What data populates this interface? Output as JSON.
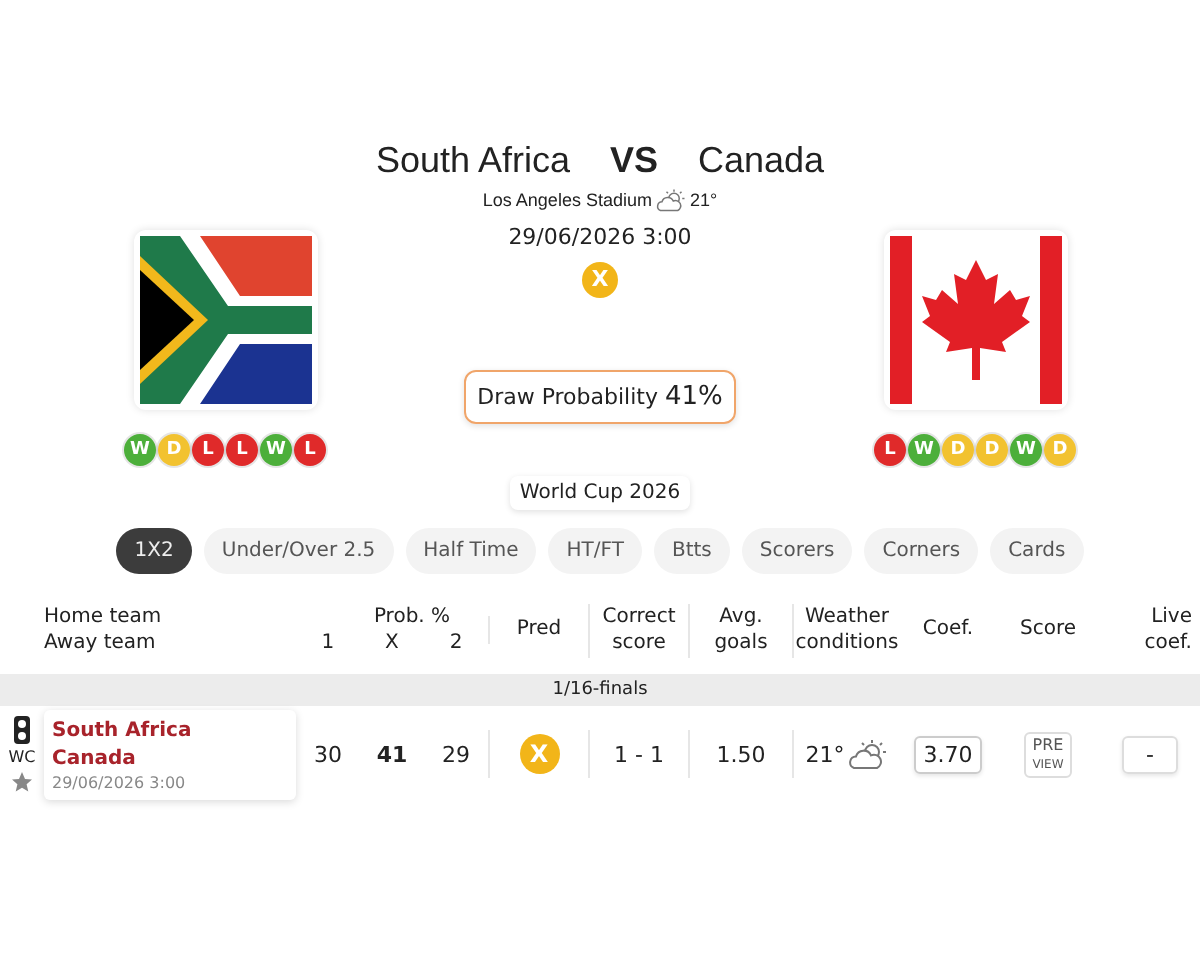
{
  "match": {
    "home": "South Africa",
    "vs": "VS",
    "away": "Canada",
    "venue": "Los Angeles Stadium",
    "temperature": "21°",
    "datetime": "29/06/2026 3:00",
    "prediction": "X",
    "draw_probability": {
      "label": "Draw Probability",
      "value": "41%"
    },
    "competition": "World Cup 2026"
  },
  "home_team": {
    "form": [
      {
        "result": "W",
        "color": "#4caf3a"
      },
      {
        "result": "D",
        "color": "#f2c230"
      },
      {
        "result": "L",
        "color": "#e02a2a"
      },
      {
        "result": "L",
        "color": "#e02a2a"
      },
      {
        "result": "W",
        "color": "#4caf3a"
      },
      {
        "result": "L",
        "color": "#e02a2a"
      }
    ]
  },
  "away_team": {
    "form": [
      {
        "result": "L",
        "color": "#e02a2a"
      },
      {
        "result": "W",
        "color": "#4caf3a"
      },
      {
        "result": "D",
        "color": "#f2c230"
      },
      {
        "result": "D",
        "color": "#f2c230"
      },
      {
        "result": "W",
        "color": "#4caf3a"
      },
      {
        "result": "D",
        "color": "#f2c230"
      }
    ]
  },
  "tabs": [
    {
      "label": "1X2",
      "selected": true
    },
    {
      "label": "Under/Over 2.5",
      "selected": false
    },
    {
      "label": "Half Time",
      "selected": false
    },
    {
      "label": "HT/FT",
      "selected": false
    },
    {
      "label": "Btts",
      "selected": false
    },
    {
      "label": "Scorers",
      "selected": false
    },
    {
      "label": "Corners",
      "selected": false
    },
    {
      "label": "Cards",
      "selected": false
    }
  ],
  "table": {
    "columns": {
      "home_team": "Home team",
      "away_team": "Away team",
      "prob": "Prob. %",
      "p1": "1",
      "px": "X",
      "p2": "2",
      "pred": "Pred",
      "correct_score": "Correct score",
      "avg_goals": "Avg. goals",
      "weather": "Weather conditions",
      "coef": "Coef.",
      "score": "Score",
      "live_coef": "Live coef."
    },
    "section": "1/16-finals",
    "rows": [
      {
        "competition": "WC",
        "home": "South Africa",
        "away": "Canada",
        "datetime": "29/06/2026 3:00",
        "p1": "30",
        "px": "41",
        "p2": "29",
        "pred": "X",
        "correct_score": "1 - 1",
        "avg_goals": "1.50",
        "temperature": "21°",
        "coef": "3.70",
        "preview": [
          "PRE",
          "VIEW"
        ],
        "live_coef": "-"
      }
    ]
  }
}
